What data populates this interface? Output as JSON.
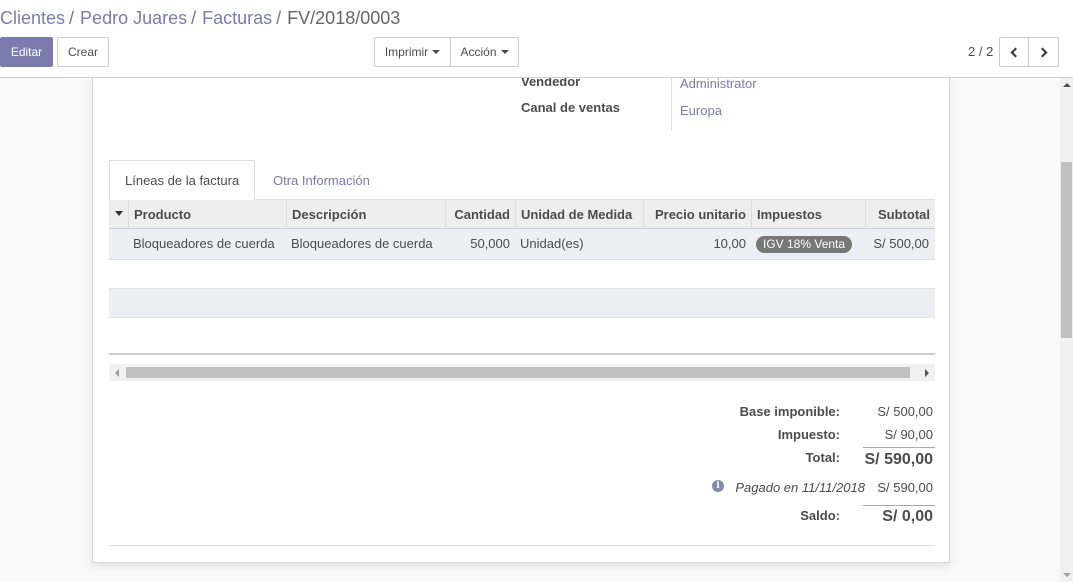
{
  "breadcrumb": {
    "items": [
      "Clientes",
      "Pedro Juares",
      "Facturas"
    ],
    "separator": "/",
    "current": "FV/2018/0003"
  },
  "toolbar": {
    "edit_label": "Editar",
    "create_label": "Crear",
    "print_label": "Imprimir",
    "action_label": "Acción"
  },
  "pager": {
    "value": "2 / 2"
  },
  "fields": {
    "salesperson_label": "Vendedor",
    "salesperson_value": "Administrator",
    "sales_channel_label": "Canal de ventas",
    "sales_channel_value": "Europa"
  },
  "tabs": [
    {
      "label": "Líneas de la factura",
      "active": true
    },
    {
      "label": "Otra Información",
      "active": false
    }
  ],
  "table": {
    "columns": [
      "Producto",
      "Descripción",
      "Cantidad",
      "Unidad de Medida",
      "Precio unitario",
      "Impuestos",
      "Subtotal"
    ],
    "rows": [
      {
        "product": "Bloqueadores de cuerda",
        "description": "Bloqueadores de cuerda",
        "quantity": "50,000",
        "uom": "Unidad(es)",
        "unit_price": "10,00",
        "tax": "IGV 18% Venta",
        "subtotal": "S/ 500,00"
      }
    ]
  },
  "totals": {
    "base_label": "Base imponible:",
    "base_value": "S/ 500,00",
    "tax_label": "Impuesto:",
    "tax_value": "S/ 90,00",
    "total_label": "Total:",
    "total_value": "S/ 590,00",
    "payment_label": "Pagado en 11/11/2018",
    "payment_value": "S/ 590,00",
    "balance_label": "Saldo:",
    "balance_value": "S/ 0,00"
  },
  "colors": {
    "accent": "#7c7bad",
    "badge": "#777777",
    "row_highlight": "#eeeef5"
  },
  "icons": {
    "sort": "caret-down-icon",
    "prev": "chevron-left-icon",
    "next": "chevron-right-icon",
    "payment_info": "info-circle-icon"
  }
}
